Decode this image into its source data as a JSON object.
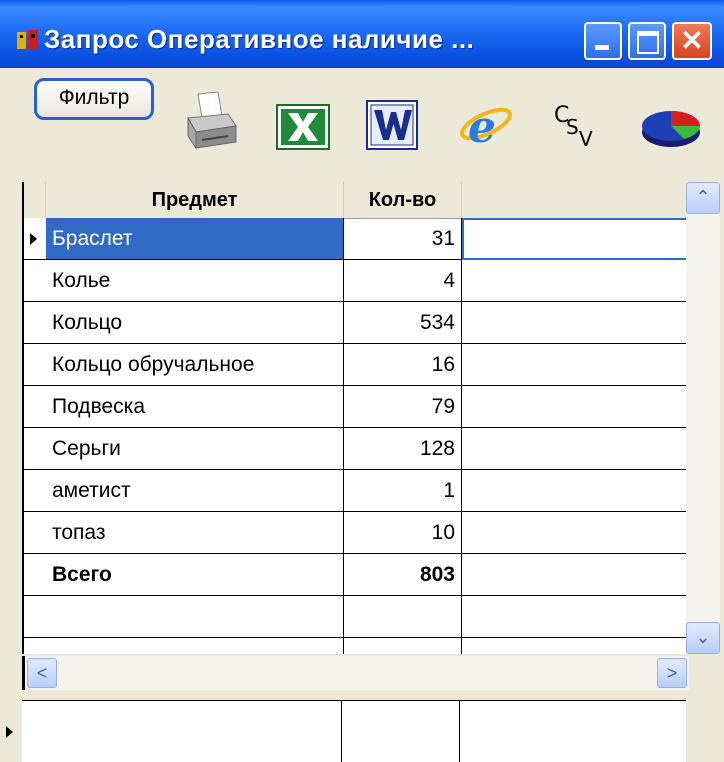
{
  "window": {
    "title": "Запрос Оперативное наличие ...",
    "close_glyph": "✕"
  },
  "toolbar": {
    "filter_label": "Фильтр",
    "icons": [
      "printer-icon",
      "excel-icon",
      "word-icon",
      "internet-explorer-icon",
      "csv-icon",
      "pie-chart-icon"
    ]
  },
  "grid": {
    "columns": [
      "Предмет",
      "Кол-во"
    ],
    "rows": [
      {
        "name": "Браслет",
        "qty": "31"
      },
      {
        "name": "Колье",
        "qty": "4"
      },
      {
        "name": "Кольцо",
        "qty": "534"
      },
      {
        "name": "Кольцо обручальное",
        "qty": "16"
      },
      {
        "name": "Подвеска",
        "qty": "79"
      },
      {
        "name": "Серьги",
        "qty": "128"
      },
      {
        "name": "аметист",
        "qty": "1"
      },
      {
        "name": "топаз",
        "qty": "10"
      },
      {
        "name": "Всего",
        "qty": "803"
      },
      {
        "name": "",
        "qty": ""
      },
      {
        "name": "",
        "qty": ""
      }
    ],
    "selected_row": 0,
    "total_row": 8
  },
  "scroll": {
    "up": "⌃",
    "down": "⌄",
    "left": "<",
    "right": ">"
  },
  "colors": {
    "titlebar": "#0a5ef0",
    "selection": "#316ac5",
    "window_bg": "#ece9d8"
  }
}
